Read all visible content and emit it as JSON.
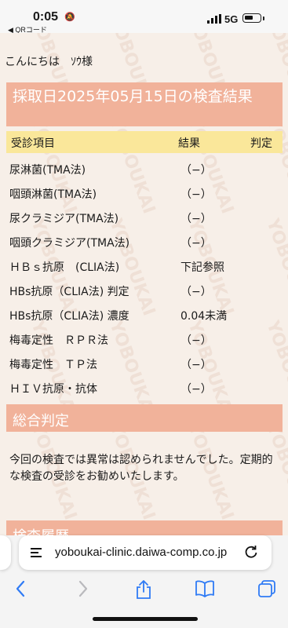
{
  "status_bar": {
    "time": "0:05",
    "back_app": "◀ QRコード",
    "network": "5G",
    "battery": "low"
  },
  "watermark_text": "YOBOUKAI",
  "greeting": "こんにちは　ｿｳ様",
  "result_header": "採取日2025年05月15日の検査結果",
  "columns": {
    "item": "受診項目",
    "result": "結果",
    "judgement": "判定"
  },
  "results": [
    {
      "item": "尿淋菌(TMA法)",
      "result": "（−）"
    },
    {
      "item": "咽頭淋菌(TMA法)",
      "result": "（−）"
    },
    {
      "item": "尿クラミジア(TMA法)",
      "result": "（−）"
    },
    {
      "item": "咽頭クラミジア(TMA法)",
      "result": "（−）"
    },
    {
      "item": "ＨＢｓ抗原　(CLIA法)",
      "result": "下記参照"
    },
    {
      "item": "HBs抗原（CLIA法) 判定",
      "result": "（−）"
    },
    {
      "item": "HBs抗原（CLIA法) 濃度",
      "result": "0.04未満"
    },
    {
      "item": "梅毒定性　ＲＰＲ法",
      "result": "（−）"
    },
    {
      "item": "梅毒定性　ＴＰ法",
      "result": "（−）"
    },
    {
      "item": "ＨＩＶ抗原・抗体",
      "result": "（−）"
    }
  ],
  "summary_header": "総合判定",
  "summary_text": "今回の検査では異常は認められませんでした。定期的な検査の受診をお勧めいたします。",
  "history_header": "検査履歴",
  "browser": {
    "url": "yoboukai-clinic.daiwa-comp.co.jp",
    "icons": [
      "back-icon",
      "forward-icon",
      "share-icon",
      "bookmarks-icon",
      "tabs-icon",
      "reload-icon",
      "page-menu-icon"
    ]
  },
  "colors": {
    "header_bg": "#f1b29a",
    "column_bg": "#fae79a",
    "page_bg": "#f7efe8",
    "link_blue": "#2f7bf5"
  }
}
